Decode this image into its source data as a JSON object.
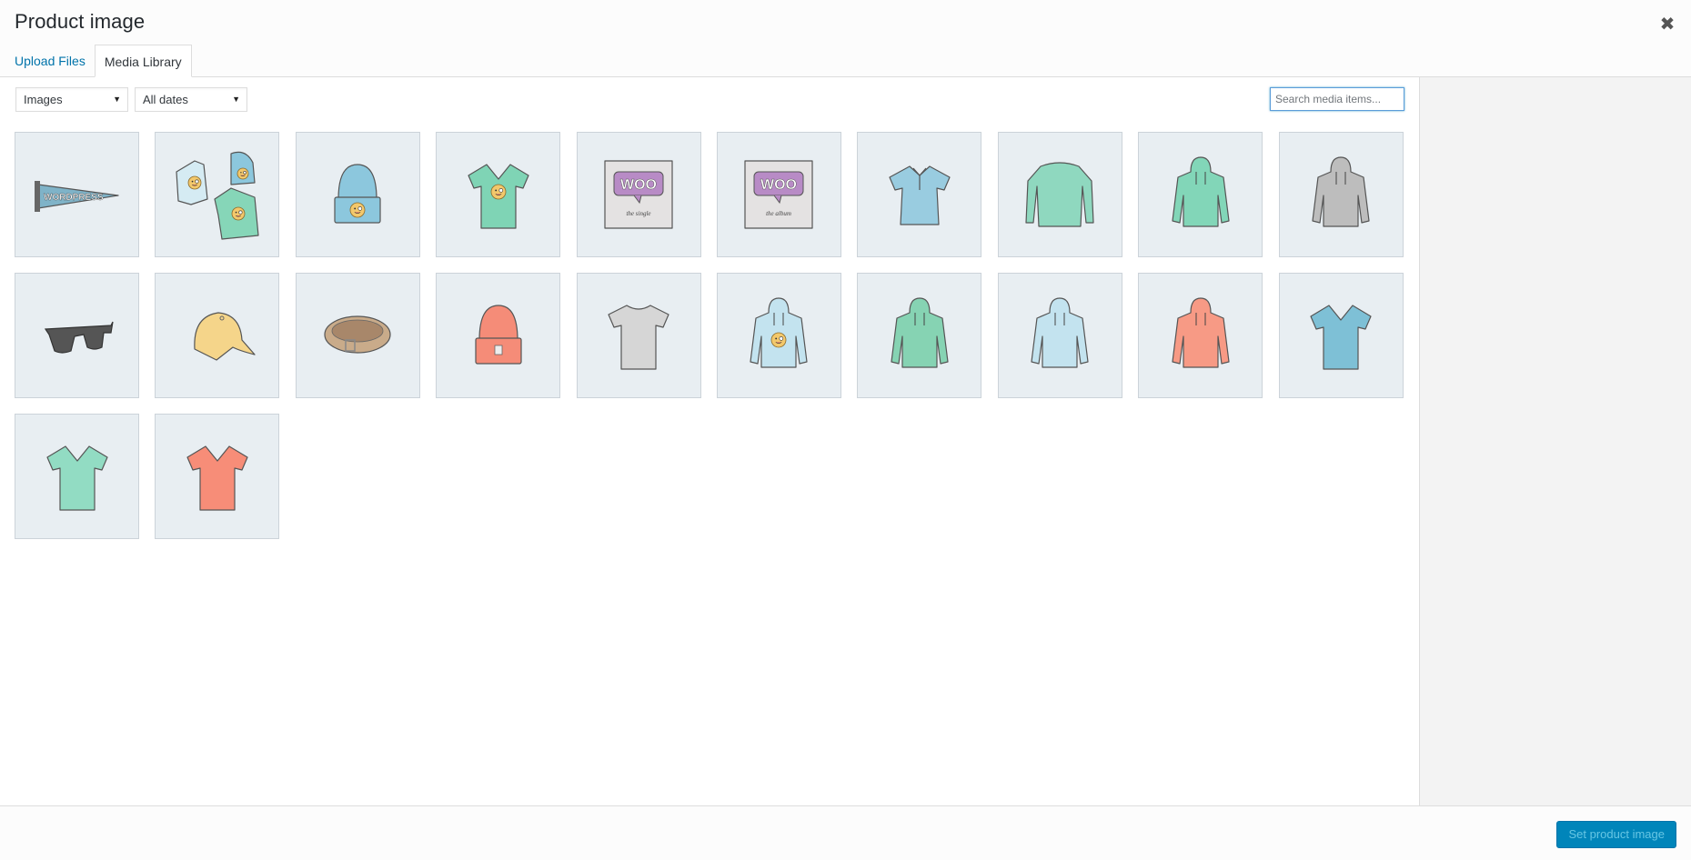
{
  "modal": {
    "title": "Product image",
    "close_icon": "close-icon"
  },
  "tabs": [
    {
      "label": "Upload Files",
      "active": false
    },
    {
      "label": "Media Library",
      "active": true
    }
  ],
  "toolbar": {
    "type_filter": {
      "selected": "Images"
    },
    "date_filter": {
      "selected": "All dates"
    },
    "search": {
      "value": "",
      "placeholder": "Search media items..."
    }
  },
  "media_items": [
    {
      "name": "pennant",
      "kind": "pennant",
      "color": "#7fb3c8"
    },
    {
      "name": "logo-collection",
      "kind": "collection",
      "color": "#a8d8e8"
    },
    {
      "name": "beanie-with-logo",
      "kind": "beanie",
      "color": "#8cc7dd",
      "logo": true
    },
    {
      "name": "v-neck-tshirt-with-logo",
      "kind": "vneck",
      "color": "#7fd4b5",
      "logo": true
    },
    {
      "name": "woo-single",
      "kind": "album",
      "color": "#b88bc6",
      "caption": "the single"
    },
    {
      "name": "woo-album",
      "kind": "album",
      "color": "#b88bc6",
      "caption": "the album"
    },
    {
      "name": "polo",
      "kind": "polo",
      "color": "#99cce0"
    },
    {
      "name": "long-sleeve-tee",
      "kind": "longsleeve",
      "color": "#8fd8bf"
    },
    {
      "name": "hoodie-with-zipper",
      "kind": "hoodie",
      "color": "#82d6b8"
    },
    {
      "name": "hoodie-gray",
      "kind": "hoodie",
      "color": "#bdbdbd"
    },
    {
      "name": "sunglasses",
      "kind": "sunglasses",
      "color": "#555555"
    },
    {
      "name": "cap",
      "kind": "cap",
      "color": "#f5d58a"
    },
    {
      "name": "belt",
      "kind": "belt",
      "color": "#c9ab8a"
    },
    {
      "name": "beanie-red",
      "kind": "beanie",
      "color": "#f58c78",
      "logo": false
    },
    {
      "name": "tshirt-gray",
      "kind": "tshirt",
      "color": "#d6d6d6"
    },
    {
      "name": "hoodie-with-logo",
      "kind": "hoodie",
      "color": "#c3e3ef",
      "logo": true
    },
    {
      "name": "hoodie-green",
      "kind": "hoodie",
      "color": "#86d3b3"
    },
    {
      "name": "hoodie-light-blue",
      "kind": "hoodie",
      "color": "#c3e3ef"
    },
    {
      "name": "hoodie-red",
      "kind": "hoodie",
      "color": "#f79a85"
    },
    {
      "name": "v-neck-tshirt-blue",
      "kind": "vneck",
      "color": "#7ec0d6"
    },
    {
      "name": "v-neck-tshirt-green",
      "kind": "vneck",
      "color": "#92dcc3"
    },
    {
      "name": "v-neck-tshirt-red",
      "kind": "vneck",
      "color": "#f78d78"
    }
  ],
  "footer": {
    "primary_button_label": "Set product image",
    "primary_button_enabled": false
  },
  "colors": {
    "accent": "#0085ba",
    "link": "#0073aa",
    "tile_bg": "#e8eef2"
  }
}
